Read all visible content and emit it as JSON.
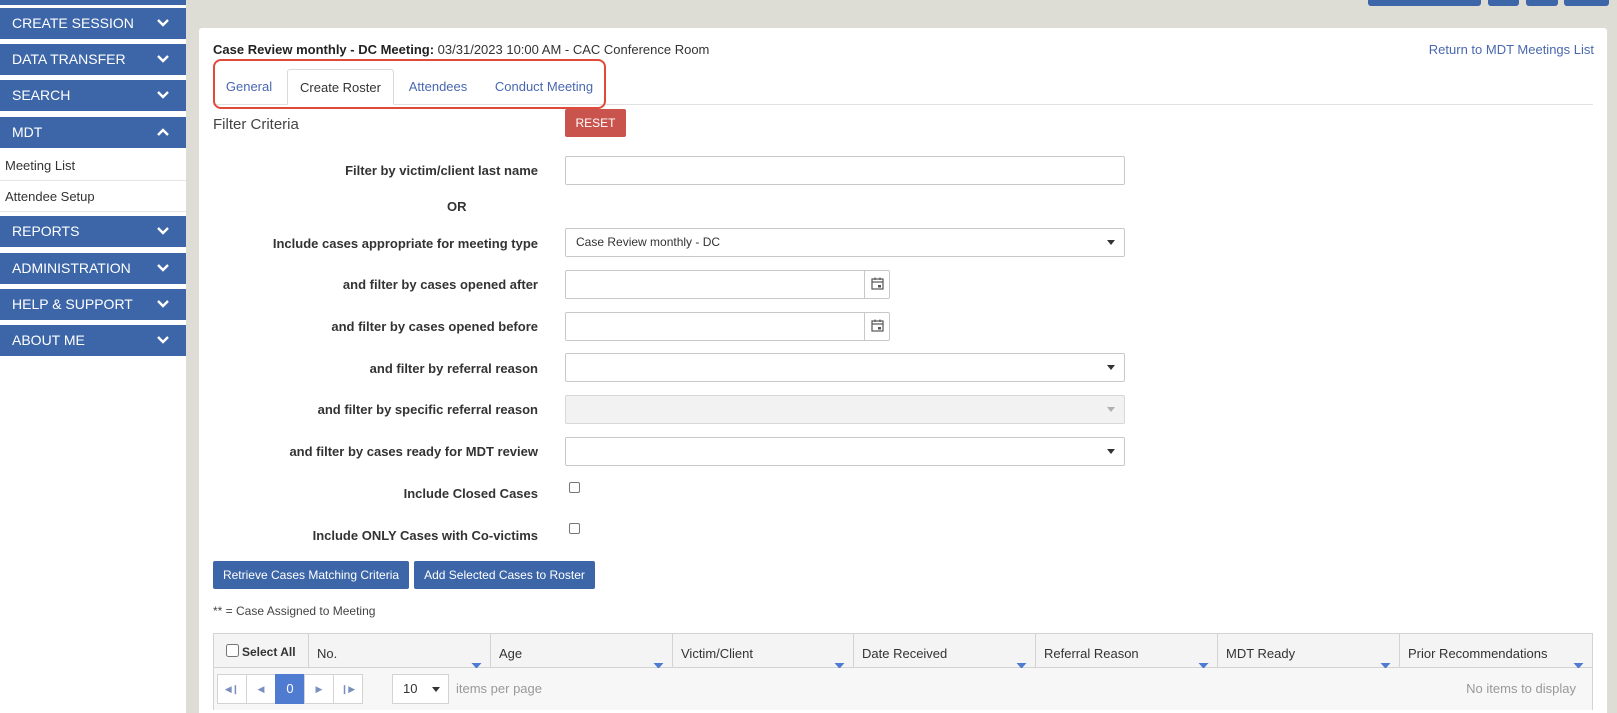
{
  "sidebar": {
    "items": [
      {
        "label": "CREATE SESSION",
        "expanded": false
      },
      {
        "label": "DATA TRANSFER",
        "expanded": false
      },
      {
        "label": "SEARCH",
        "expanded": false
      },
      {
        "label": "MDT",
        "expanded": true
      },
      {
        "label": "REPORTS",
        "expanded": false
      },
      {
        "label": "ADMINISTRATION",
        "expanded": false
      },
      {
        "label": "HELP & SUPPORT",
        "expanded": false
      },
      {
        "label": "ABOUT ME",
        "expanded": false
      }
    ],
    "mdt_subitems": [
      "Meeting List",
      "Attendee Setup"
    ]
  },
  "header": {
    "meeting_label": "Case Review monthly - DC Meeting:",
    "meeting_details": "03/31/2023 10:00 AM - CAC Conference Room",
    "return_link": "Return to MDT Meetings List"
  },
  "tabs": [
    {
      "label": "General",
      "active": false
    },
    {
      "label": "Create Roster",
      "active": true
    },
    {
      "label": "Attendees",
      "active": false
    },
    {
      "label": "Conduct Meeting",
      "active": false
    }
  ],
  "filter": {
    "heading": "Filter Criteria",
    "reset_label": "RESET",
    "last_name_label": "Filter by victim/client last name",
    "last_name_value": "",
    "or_label": "OR",
    "meeting_type_label": "Include cases appropriate for meeting type",
    "meeting_type_value": "Case Review monthly - DC",
    "opened_after_label": "and filter by cases opened after",
    "opened_after_value": "",
    "opened_before_label": "and filter by cases opened before",
    "opened_before_value": "",
    "referral_reason_label": "and filter by referral reason",
    "referral_reason_value": "",
    "specific_referral_label": "and filter by specific referral reason",
    "specific_referral_value": "",
    "mdt_ready_label": "and filter by cases ready for MDT review",
    "mdt_ready_value": "",
    "closed_cases_label": "Include Closed Cases",
    "closed_cases_checked": false,
    "covictims_label": "Include ONLY Cases with Co-victims",
    "covictims_checked": false
  },
  "actions": {
    "retrieve_label": "Retrieve Cases Matching Criteria",
    "add_label": "Add Selected Cases to Roster"
  },
  "legend_note": "** = Case Assigned to Meeting",
  "grid": {
    "select_all_label": "Select All",
    "columns": [
      "No.",
      "Age",
      "Victim/Client",
      "Date Received",
      "Referral Reason",
      "MDT Ready",
      "Prior Recommendations"
    ],
    "rows": [],
    "pager": {
      "current_page": "0",
      "page_size": "10",
      "items_per_page_label": "items per page",
      "empty_text": "No items to display"
    }
  },
  "colors": {
    "sidebar_blue": "#3d66a8",
    "link_blue": "#4a68b0",
    "reset_red": "#c9544e",
    "highlight_red": "#e04a3a",
    "background_gray": "#dddcd5"
  },
  "icons": {
    "chevron_down": "chevron-down-icon",
    "chevron_up": "chevron-up-icon",
    "calendar": "calendar-icon",
    "filter": "filter-icon"
  }
}
